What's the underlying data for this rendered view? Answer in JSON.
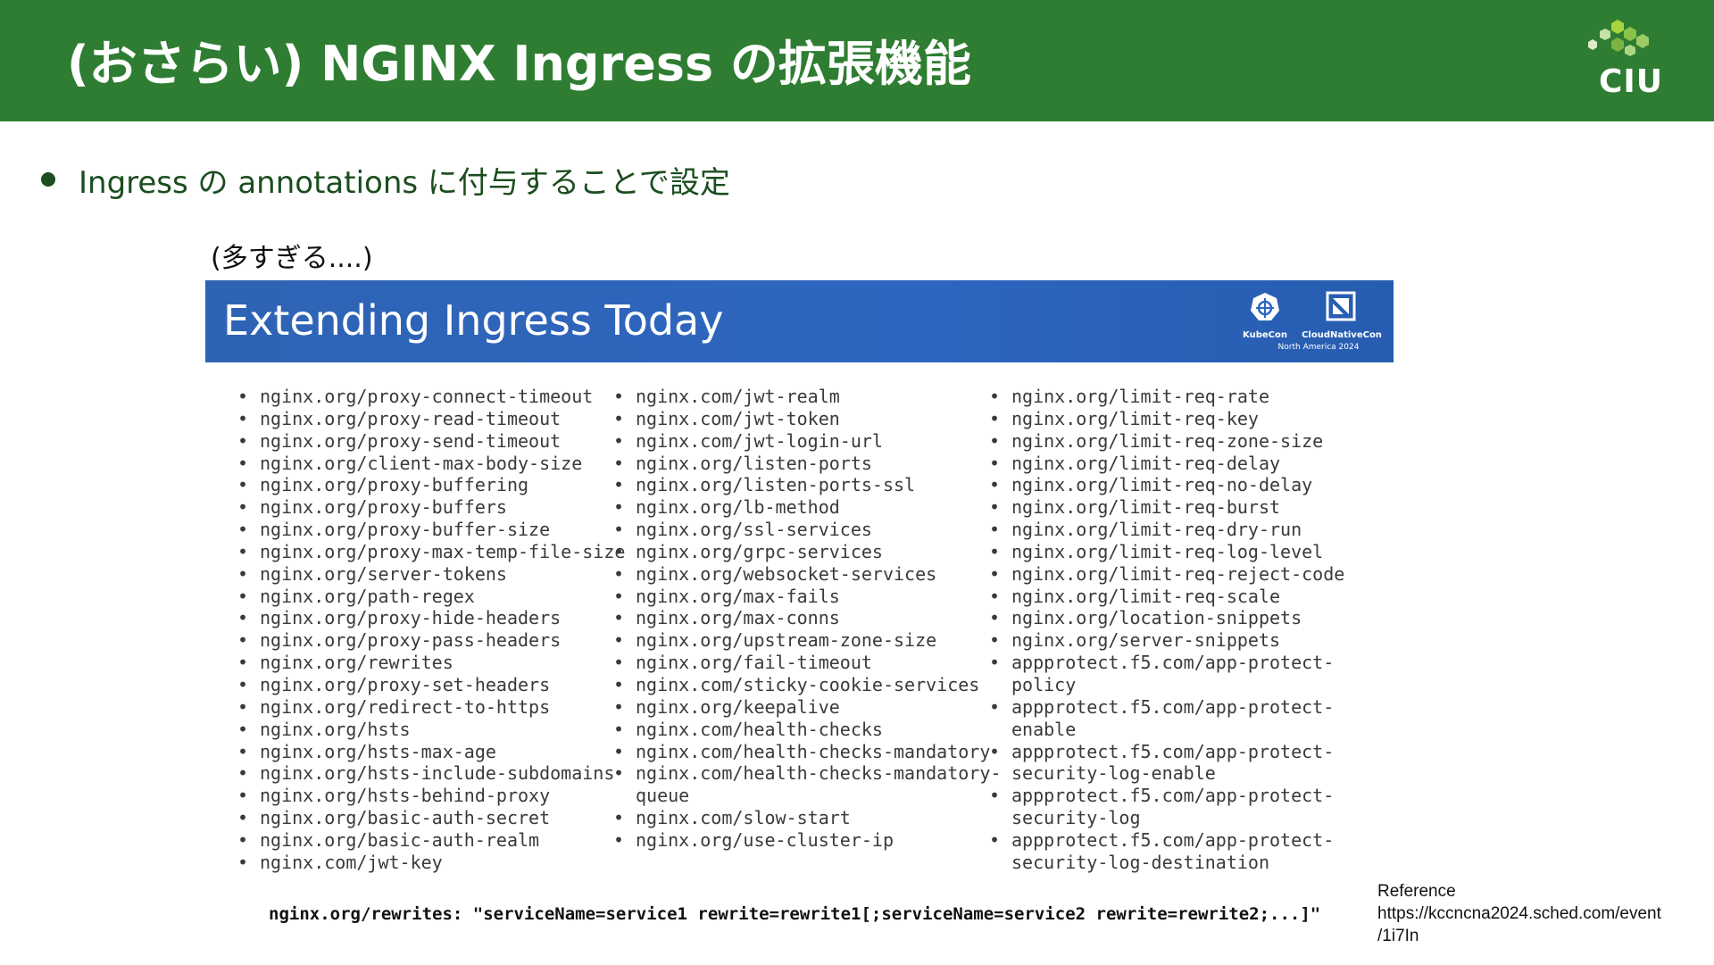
{
  "header": {
    "title": "(おさらい) NGINX Ingress の拡張機能",
    "bg_color": "#2e7d32",
    "logo": {
      "icon": "hexagon-cluster-logo",
      "text": "CIU"
    }
  },
  "main": {
    "bullet": "Ingress の annotations に付与することで設定",
    "aside": "(多すぎる....)"
  },
  "embedded_slide": {
    "title": "Extending Ingress Today",
    "bg_color": "#2d66c0",
    "event_logos": {
      "kubecon": "KubeCon",
      "cloudnativecon": "CloudNativeCon",
      "subtitle": "North America 2024"
    },
    "columns": [
      [
        "nginx.org/proxy-connect-timeout",
        "nginx.org/proxy-read-timeout",
        "nginx.org/proxy-send-timeout",
        "nginx.org/client-max-body-size",
        "nginx.org/proxy-buffering",
        "nginx.org/proxy-buffers",
        "nginx.org/proxy-buffer-size",
        "nginx.org/proxy-max-temp-file-size",
        "nginx.org/server-tokens",
        "nginx.org/path-regex",
        "nginx.org/proxy-hide-headers",
        "nginx.org/proxy-pass-headers",
        "nginx.org/rewrites",
        "nginx.org/proxy-set-headers",
        "nginx.org/redirect-to-https",
        "nginx.org/hsts",
        "nginx.org/hsts-max-age",
        "nginx.org/hsts-include-subdomains",
        "nginx.org/hsts-behind-proxy",
        "nginx.org/basic-auth-secret",
        "nginx.org/basic-auth-realm",
        "nginx.com/jwt-key"
      ],
      [
        "nginx.com/jwt-realm",
        "nginx.com/jwt-token",
        "nginx.com/jwt-login-url",
        "nginx.org/listen-ports",
        "nginx.org/listen-ports-ssl",
        "nginx.org/lb-method",
        "nginx.org/ssl-services",
        "nginx.org/grpc-services",
        "nginx.org/websocket-services",
        "nginx.org/max-fails",
        "nginx.org/max-conns",
        "nginx.org/upstream-zone-size",
        "nginx.org/fail-timeout",
        "nginx.com/sticky-cookie-services",
        "nginx.org/keepalive",
        "nginx.com/health-checks",
        "nginx.com/health-checks-mandatory",
        "nginx.com/health-checks-mandatory-\nqueue",
        "nginx.com/slow-start",
        "nginx.org/use-cluster-ip"
      ],
      [
        "nginx.org/limit-req-rate",
        "nginx.org/limit-req-key",
        "nginx.org/limit-req-zone-size",
        "nginx.org/limit-req-delay",
        "nginx.org/limit-req-no-delay",
        "nginx.org/limit-req-burst",
        "nginx.org/limit-req-dry-run",
        "nginx.org/limit-req-log-level",
        "nginx.org/limit-req-reject-code",
        "nginx.org/limit-req-scale",
        "nginx.org/location-snippets",
        "nginx.org/server-snippets",
        "appprotect.f5.com/app-protect-\npolicy",
        "appprotect.f5.com/app-protect-\nenable",
        "appprotect.f5.com/app-protect-\nsecurity-log-enable",
        "appprotect.f5.com/app-protect-\nsecurity-log",
        "appprotect.f5.com/app-protect-\nsecurity-log-destination"
      ]
    ]
  },
  "example": "nginx.org/rewrites: \"serviceName=service1 rewrite=rewrite1[;serviceName=service2 rewrite=rewrite2;...]\"",
  "reference": {
    "label": "Reference",
    "url_line1": "https://kccncna2024.sched.com/event",
    "url_line2": "/1i7In"
  }
}
